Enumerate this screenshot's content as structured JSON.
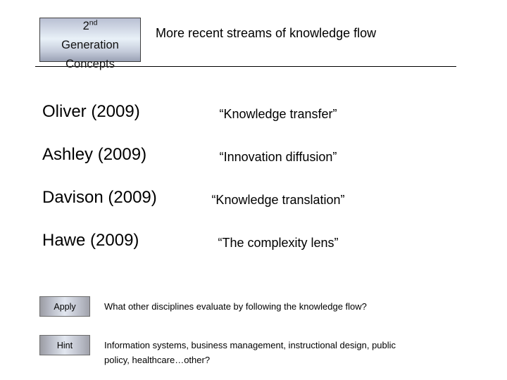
{
  "slide": {
    "title": "More recent streams of knowledge flow",
    "badge": {
      "line1_number": "2",
      "line1_suffix": "nd",
      "line2": "Generation",
      "line3": "Concepts"
    }
  },
  "entries": [
    {
      "author": "Oliver (2009)",
      "concept": "“Knowledge transfer”"
    },
    {
      "author": "Ashley (2009)",
      "concept": "“Innovation diffusion”"
    },
    {
      "author": "Davison (2009)",
      "concept": "“Knowledge translation”"
    },
    {
      "author": "Hawe (2009)",
      "concept": "“The complexity lens”"
    }
  ],
  "prompts": {
    "apply": {
      "label": "Apply",
      "text": "What other disciplines evaluate by following the knowledge flow?"
    },
    "hint": {
      "label": "Hint",
      "text_line1": "Information systems, business management, instructional design, public",
      "text_line2": "policy, healthcare…other?"
    }
  },
  "colors": {
    "badge_top": "#b9c0d3",
    "badge_center": "#e9f1f8",
    "badge_bottom": "#9aa2b5",
    "button_center": "#e2e7f0",
    "rule": "#000000",
    "text": "#000000"
  }
}
